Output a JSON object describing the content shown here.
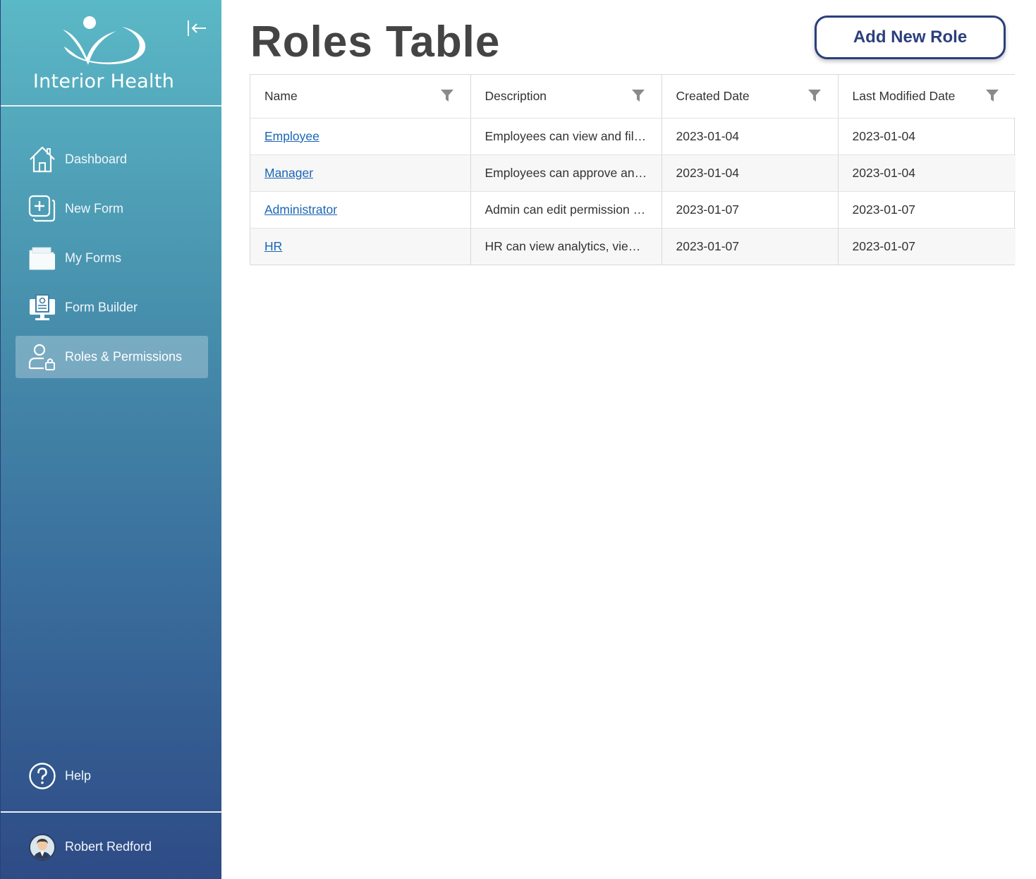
{
  "brand": {
    "name": "Interior Health"
  },
  "sidebar": {
    "items": [
      {
        "label": "Dashboard",
        "icon": "home-icon",
        "active": false
      },
      {
        "label": "New Form",
        "icon": "add-form-icon",
        "active": false
      },
      {
        "label": "My Forms",
        "icon": "folder-icon",
        "active": false
      },
      {
        "label": "Form Builder",
        "icon": "form-builder-icon",
        "active": false
      },
      {
        "label": "Roles & Permissions",
        "icon": "user-lock-icon",
        "active": true
      }
    ],
    "help_label": "Help",
    "user_name": "Robert Redford"
  },
  "main": {
    "title": "Roles Table",
    "add_button_label": "Add New Role",
    "table": {
      "columns": [
        "Name",
        "Description",
        "Created Date",
        "Last Modified Date"
      ],
      "rows": [
        {
          "name": "Employee",
          "description": "Employees can view and fil…",
          "created": "2023-01-04",
          "modified": "2023-01-04"
        },
        {
          "name": "Manager",
          "description": "Employees can approve an…",
          "created": "2023-01-04",
          "modified": "2023-01-04"
        },
        {
          "name": "Administrator",
          "description": "Admin can edit permission …",
          "created": "2023-01-07",
          "modified": "2023-01-07"
        },
        {
          "name": "HR",
          "description": "HR can view analytics, vie…",
          "created": "2023-01-07",
          "modified": "2023-01-07"
        }
      ]
    }
  },
  "colors": {
    "sidebar_top": "#5bb8c6",
    "sidebar_bottom": "#2e4b86",
    "accent": "#2b3f7c",
    "link": "#1a66b5",
    "title": "#444444"
  }
}
